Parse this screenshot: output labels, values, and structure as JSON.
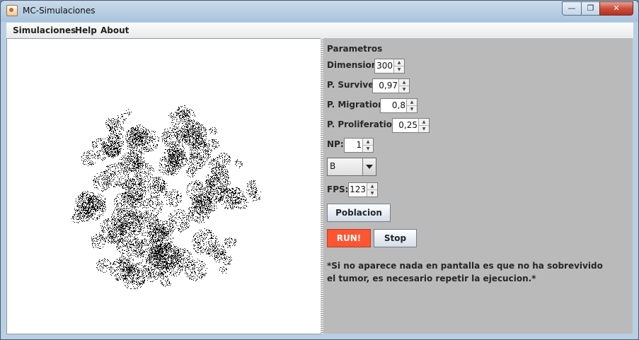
{
  "window": {
    "title": "MC-Simulaciones",
    "minimize": "—",
    "maximize": "❐",
    "close": "✕"
  },
  "menu": {
    "items": [
      "Simulaciones",
      "Help",
      "About"
    ]
  },
  "params": {
    "heading": "Parametros",
    "dimension": {
      "label": "Dimension:",
      "value": "300"
    },
    "survive": {
      "label": "P. Survive:",
      "value": "0,97"
    },
    "migration": {
      "label": "P. Migration:",
      "value": "0,8"
    },
    "proliferation": {
      "label": "P. Proliferation:",
      "value": "0,25"
    },
    "np": {
      "label": "NP:",
      "value": "1"
    },
    "combo": {
      "selected": "B"
    },
    "fps": {
      "label": "FPS:",
      "value": "123"
    }
  },
  "buttons": {
    "poblacion": "Poblacion",
    "run": "RUN!",
    "stop": "Stop"
  },
  "note": {
    "line1": "*Si no aparece nada en pantalla es que no ha sobrevivido",
    "line2": "el tumor, es necesario repetir la ejecucion.*"
  },
  "colors": {
    "run_button": "#ff5533",
    "param_panel": "#bababa",
    "cells": "#000000"
  }
}
